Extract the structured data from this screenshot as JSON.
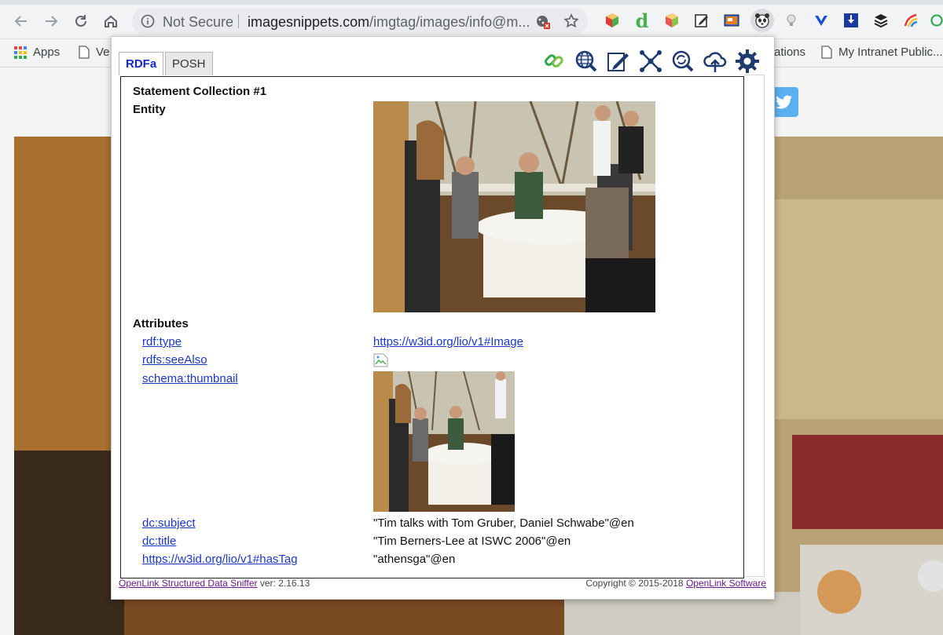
{
  "browser": {
    "url_security": "Not Secure",
    "url_domain": "imagesnippets.com",
    "url_path": "/imgtag/images/info@m...",
    "extension_d": "d"
  },
  "bookmarks": {
    "apps": "Apps",
    "item2": "Ve",
    "item3": "ations",
    "item4": "My Intranet Public..."
  },
  "popup": {
    "tabs": {
      "rdfa": "RDFa",
      "posh": "POSH"
    },
    "tools": [
      "link-icon",
      "globe-search-icon",
      "edit-icon",
      "graph-network-icon",
      "zoom-refresh-icon",
      "cloud-upload-icon",
      "settings-gear-icon"
    ],
    "collection_title": "Statement Collection #1",
    "entity_label": "Entity",
    "attributes_label": "Attributes",
    "attributes": [
      {
        "property": "rdf:type",
        "value": "https://w3id.org/lio/v1#Image",
        "value_is_link": true
      },
      {
        "property": "rdfs:seeAlso",
        "value": "",
        "value_is_link": false
      },
      {
        "property": "schema:thumbnail",
        "value": "",
        "value_is_link": false
      },
      {
        "property": "dc:subject",
        "value": "\"Tim talks with Tom Gruber, Daniel Schwabe\"@en",
        "value_is_link": false
      },
      {
        "property": "dc:title",
        "value": "\"Tim Berners-Lee at ISWC 2006\"@en",
        "value_is_link": false
      },
      {
        "property": "https://w3id.org/lio/v1#hasTag",
        "value": "\"athensga\"@en",
        "value_is_link": false
      }
    ],
    "footer": {
      "sniffer_link": "OpenLink Structured Data Sniffer",
      "version": " ver: 2.16.13",
      "copyright": "Copyright © 2015-2018 ",
      "company_link": "OpenLink Software"
    }
  }
}
